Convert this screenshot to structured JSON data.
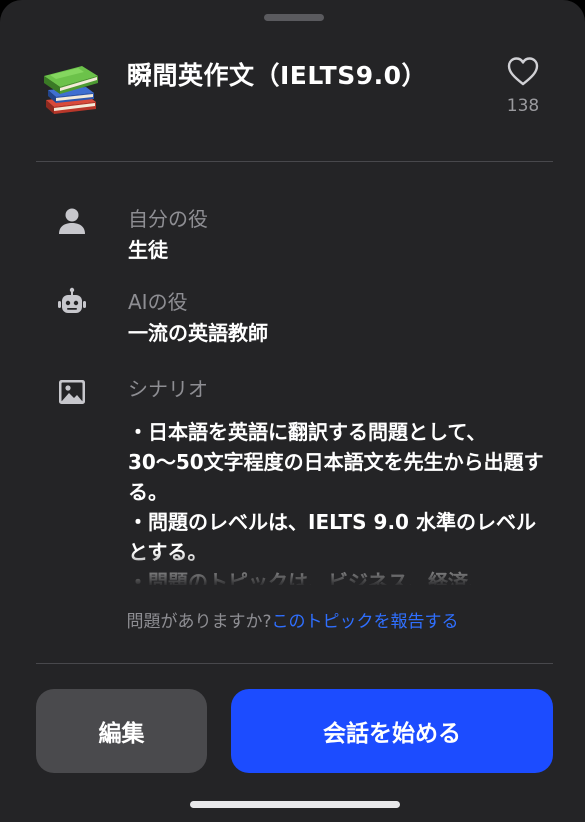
{
  "colors": {
    "sheet_background": "#242426",
    "secondary_text": "#8e8e93",
    "link": "#2f6fff",
    "primary_button": "#1c4cff",
    "secondary_button": "#4a4a4d"
  },
  "header": {
    "icon": "books-icon",
    "title": "瞬間英作文（IELTS9.0）",
    "favorite_icon": "heart-outline-icon",
    "like_count": "138"
  },
  "details": [
    {
      "icon": "person-icon",
      "label": "自分の役",
      "value": "生徒"
    },
    {
      "icon": "robot-icon",
      "label": "AIの役",
      "value": "一流の英語教師"
    },
    {
      "icon": "image-icon",
      "label": "シナリオ",
      "value": "・日本語を英語に翻訳する問題として、\n30～50文字程度の日本語文を先生から出題する。\n・問題のレベルは、IELTS 9.0 水準のレベルとする。\n・問題のトピックは、ビジネス、経済、"
    }
  ],
  "report": {
    "question": "問題がありますか?",
    "link": "このトピックを報告する"
  },
  "actions": {
    "edit_label": "編集",
    "start_label": "会話を始める"
  }
}
